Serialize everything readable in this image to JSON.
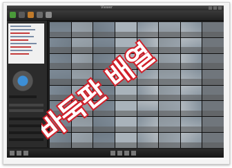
{
  "window": {
    "title": "Viewer"
  },
  "toolbar": {
    "buttons": [
      {
        "icon": "live-view-icon",
        "color": "#4a9a3a"
      },
      {
        "icon": "search-icon",
        "color": "#5a5a5a"
      },
      {
        "icon": "camera-icon",
        "color": "#c07a2a"
      },
      {
        "icon": "record-icon",
        "color": "#6a6a6a"
      },
      {
        "icon": "lock-icon",
        "color": "#8a8a8a"
      }
    ]
  },
  "overlay": {
    "label": "바둑판 배열",
    "color": "#d0202a"
  },
  "grid": {
    "rows": 8,
    "columns": 8
  },
  "colors": {
    "window_background": "#1c1c1c",
    "overlay_stroke": "#d0202a",
    "overlay_fill": "#ffffff"
  }
}
